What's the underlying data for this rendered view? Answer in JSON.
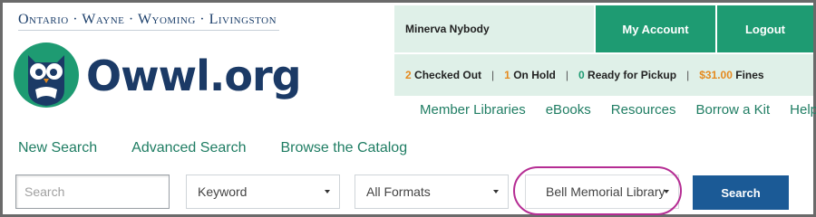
{
  "branding": {
    "counties": "Ontario · Wayne · Wyoming · Livingston",
    "brand_name": "Owwl.org",
    "logo_icon": "owl-logo-icon"
  },
  "account": {
    "user_name": "Minerva Nybody",
    "my_account_label": "My Account",
    "logout_label": "Logout"
  },
  "status": {
    "checked_out_count": "2",
    "checked_out_label": "Checked Out",
    "on_hold_count": "1",
    "on_hold_label": "On Hold",
    "ready_count": "0",
    "ready_label": "Ready for Pickup",
    "fines_amount": "$31.00",
    "fines_label": "Fines",
    "separator": "|"
  },
  "top_nav": {
    "items": [
      "Member Libraries",
      "eBooks",
      "Resources",
      "Borrow a Kit",
      "Help"
    ]
  },
  "search_links": {
    "items": [
      "New Search",
      "Advanced Search",
      "Browse the Catalog"
    ]
  },
  "search": {
    "placeholder": "Search",
    "value": "",
    "type_selected": "Keyword",
    "format_selected": "All Formats",
    "library_selected": "Bell Memorial Library",
    "submit_label": "Search"
  },
  "colors": {
    "brand_navy": "#1b3a66",
    "accent_green": "#1e9b72",
    "panel_mint": "#dff0e8",
    "count_orange": "#e58a1f",
    "search_button_blue": "#1b5a96",
    "highlight_magenta": "#b52c93"
  }
}
